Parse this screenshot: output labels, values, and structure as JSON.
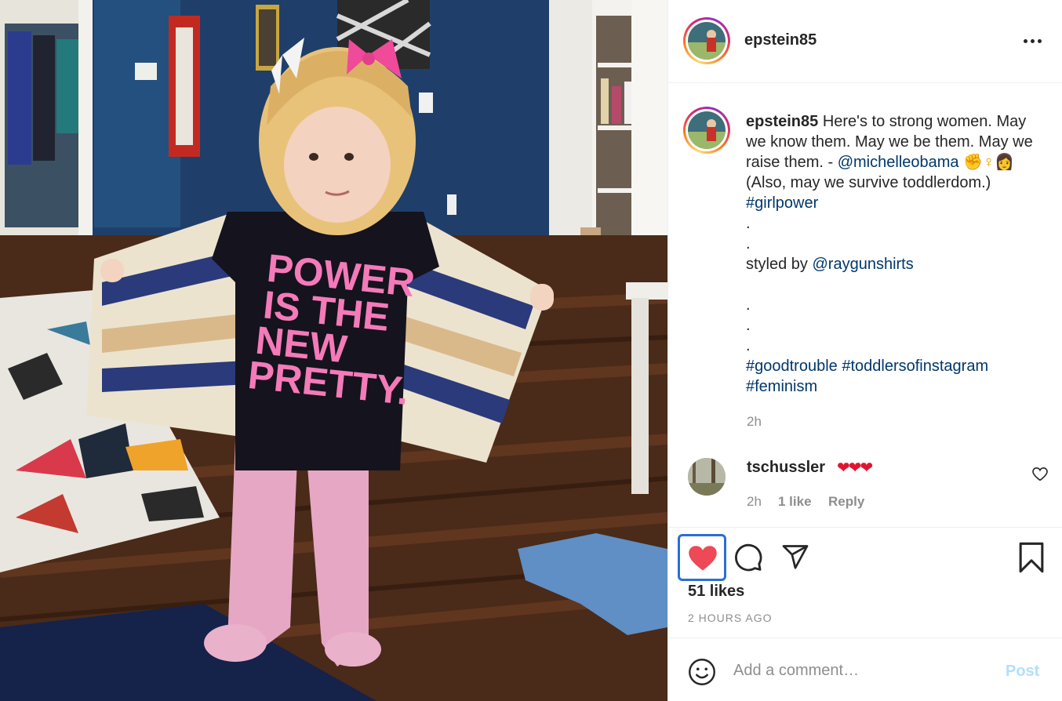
{
  "post": {
    "username": "epstein85",
    "more_icon": "more-horizontal-icon"
  },
  "caption": {
    "username": "epstein85",
    "text_1": "Here's to strong women. May we know them. May we be them. May we raise them. -",
    "mention_1": "@michelleobama",
    "emoji": "✊♀👩",
    "text_2": "(Also, may we survive toddlerdom.)",
    "hashtag_1": "#girlpower",
    "dot_1": ".",
    "dot_2": ".",
    "styled_by": "styled by",
    "mention_2": "@raygunshirts",
    "dot_3": ".",
    "dot_4": ".",
    "dot_5": ".",
    "hashtag_2": "#goodtrouble",
    "hashtag_3": "#toddlersofinstagram",
    "hashtag_4": "#feminism",
    "time": "2h"
  },
  "comment": {
    "username": "tschussler",
    "text": "❤❤❤",
    "time": "2h",
    "likes": "1 like",
    "reply": "Reply"
  },
  "actions": {
    "liked": true,
    "like_color": "#ed4956",
    "icons": [
      "heart-icon",
      "comment-icon",
      "share-icon",
      "bookmark-icon"
    ]
  },
  "likes": "51 likes",
  "posted": "2 HOURS AGO",
  "add_comment": {
    "placeholder": "Add a comment…",
    "post_label": "Post"
  },
  "photo": {
    "shirt_text": [
      "POWER",
      "IS THE",
      "NEW",
      "PRETTY."
    ]
  }
}
